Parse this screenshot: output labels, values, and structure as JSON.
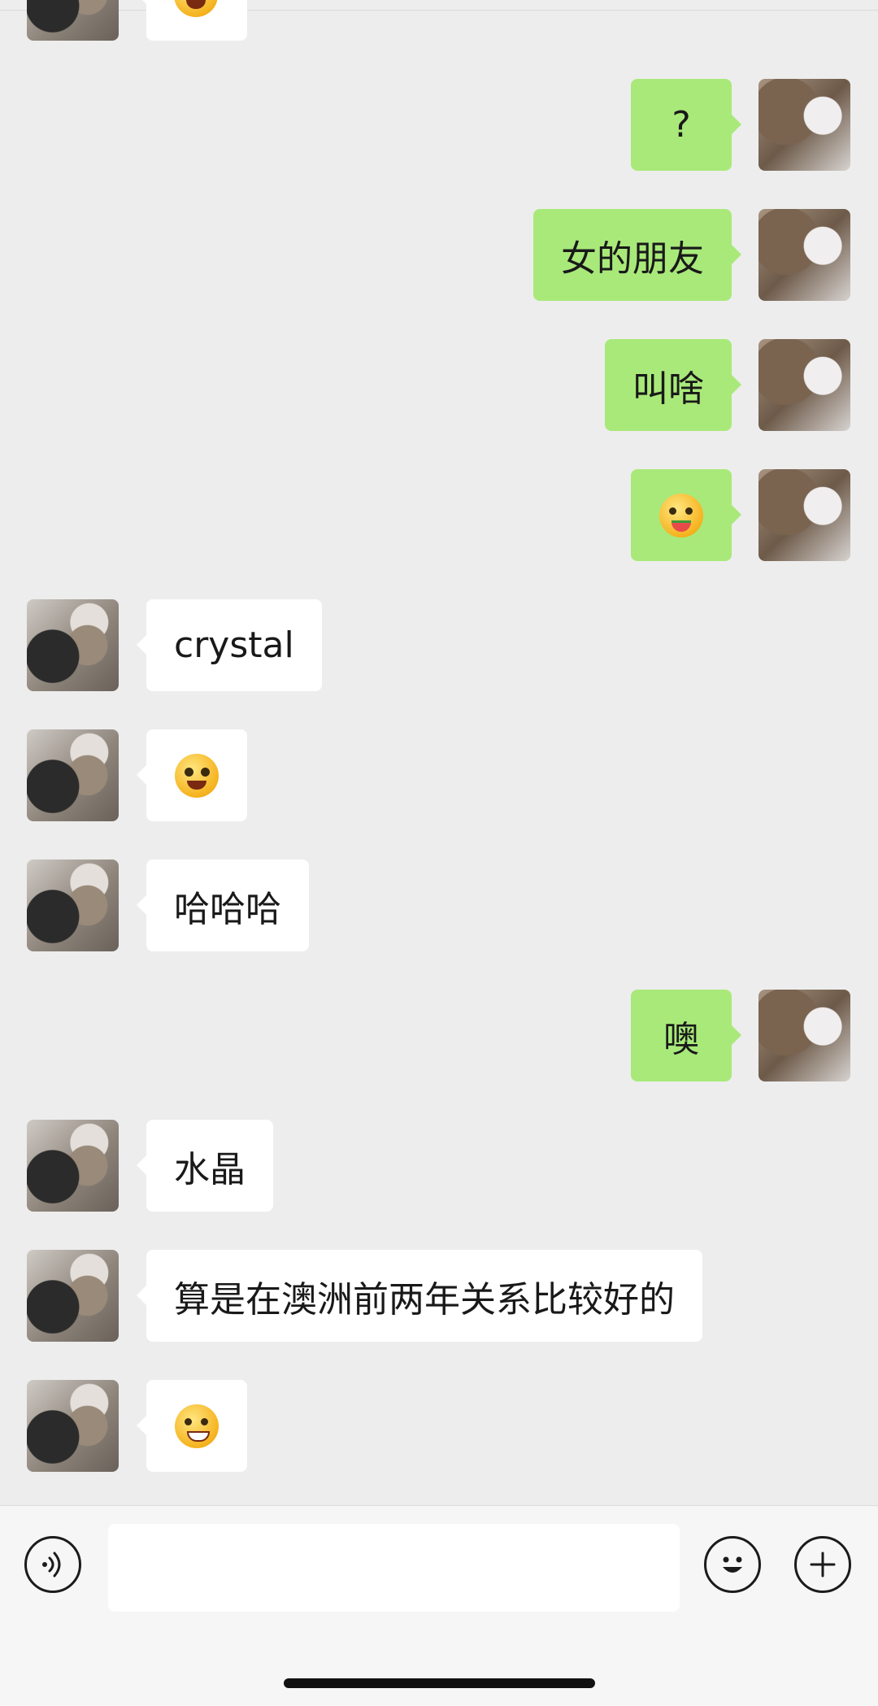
{
  "chat": {
    "messages": [
      {
        "side": "left",
        "kind": "emoji",
        "icon": "emoji-partial-icon",
        "text": ""
      },
      {
        "side": "right",
        "kind": "text",
        "text": "?"
      },
      {
        "side": "right",
        "kind": "text",
        "text": "女的朋友"
      },
      {
        "side": "right",
        "kind": "text",
        "text": "叫啥"
      },
      {
        "side": "right",
        "kind": "emoji",
        "icon": "watermelon-eating-emoji-icon",
        "text": ""
      },
      {
        "side": "left",
        "kind": "text",
        "text": "crystal"
      },
      {
        "side": "left",
        "kind": "emoji",
        "icon": "starry-eyed-emoji-icon",
        "text": ""
      },
      {
        "side": "left",
        "kind": "text",
        "text": "哈哈哈"
      },
      {
        "side": "right",
        "kind": "text",
        "text": "噢"
      },
      {
        "side": "left",
        "kind": "text",
        "text": "水晶"
      },
      {
        "side": "left",
        "kind": "text",
        "text": "算是在澳洲前两年关系比较好的"
      },
      {
        "side": "left",
        "kind": "emoji",
        "icon": "grinning-emoji-icon",
        "text": ""
      }
    ]
  },
  "input_bar": {
    "voice_icon": "voice-icon",
    "text_value": "",
    "emoji_icon": "smiley-icon",
    "plus_icon": "plus-icon"
  },
  "colors": {
    "background": "#ededed",
    "self_bubble": "#a9e97a",
    "other_bubble": "#ffffff"
  }
}
